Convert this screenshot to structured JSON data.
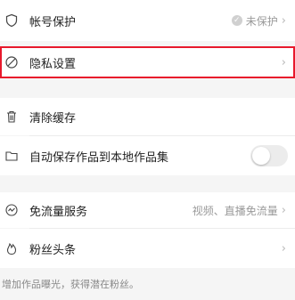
{
  "settings": {
    "account_protection": {
      "label": "帐号保护",
      "status": "未保护"
    },
    "privacy": {
      "label": "隐私设置"
    },
    "clear_cache": {
      "label": "清除缓存"
    },
    "auto_save": {
      "label": "自动保存作品到本地作品集",
      "enabled": false
    },
    "free_data": {
      "label": "免流量服务",
      "value": "视频、直播免流量"
    },
    "fans_headline": {
      "label": "粉丝头条"
    },
    "footer_note": "增加作品曝光，获得潜在粉丝。"
  },
  "colors": {
    "highlight": "#e8192c",
    "page_bg": "#f5f5f5",
    "row_bg": "#ffffff"
  },
  "icons": {
    "account_protection": "shield-icon",
    "privacy": "privacy-icon",
    "clear_cache": "trash-icon",
    "auto_save": "folder-icon",
    "free_data": "pulse-icon",
    "fans_headline": "flame-icon"
  }
}
